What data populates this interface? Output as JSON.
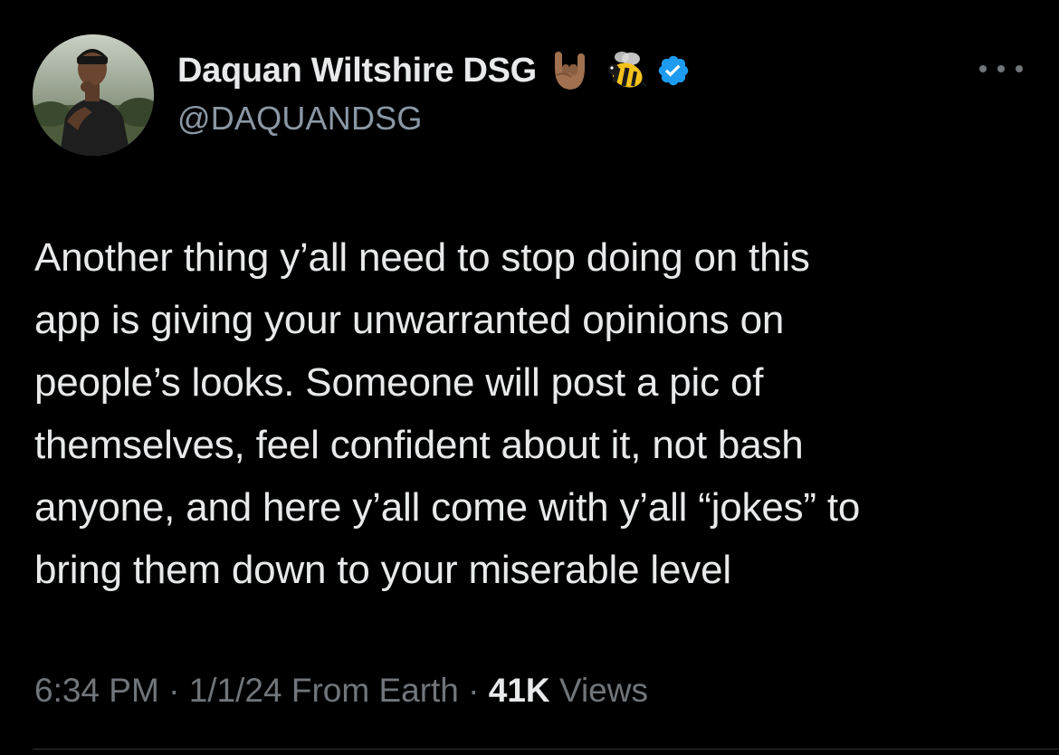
{
  "author": {
    "display_name": "Daquan Wiltshire DSG",
    "handle": "@DAQUANDSG",
    "name_emojis": [
      "horns-sign-emoji",
      "honeybee-emoji"
    ],
    "verified": true,
    "verified_color": "#1d9bf0"
  },
  "tweet": {
    "text_lines": [
      "Another thing y’all need to stop doing on this",
      "app is giving your unwarranted opinions on",
      "people’s looks. Someone will post a pic of",
      "themselves, feel confident about it, not bash",
      "anyone, and here y’all come with y’all “jokes” to",
      "bring them down to your miserable level"
    ]
  },
  "meta": {
    "time": "6:34 PM",
    "separator1": " · ",
    "date": "1/1/24",
    "source": " From Earth",
    "separator2": " · ",
    "views_count": "41K",
    "views_label": " Views"
  },
  "icons": {
    "more": "more-options-icon",
    "verified": "verified-badge-icon"
  },
  "colors": {
    "background": "#000000",
    "primary_text": "#e7e9ea",
    "secondary_text": "#71767b",
    "handle_text": "#8b98a5",
    "accent": "#1d9bf0"
  }
}
